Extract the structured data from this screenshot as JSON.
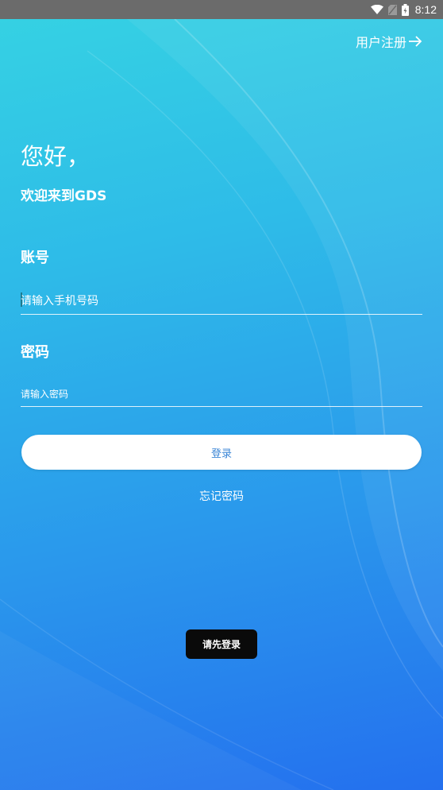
{
  "status_bar": {
    "time": "8:12",
    "icons": [
      "wifi-icon",
      "sim-card-icon",
      "battery-icon"
    ]
  },
  "header": {
    "register_label": "用户注册",
    "register_icon": "arrow-right-icon"
  },
  "greeting": {
    "title": "您好，",
    "subtitle": "欢迎来到GDS"
  },
  "form": {
    "account_label": "账号",
    "account_placeholder": "请输入手机号码",
    "account_value": "",
    "password_label": "密码",
    "password_placeholder": "请输入密码",
    "password_value": ""
  },
  "actions": {
    "login_label": "登录",
    "forgot_label": "忘记密码"
  },
  "toast": {
    "message": "请先登录"
  },
  "colors": {
    "gradient_top": "#35d1e3",
    "gradient_bottom": "#2470ee",
    "button_bg": "#ffffff",
    "button_text": "#3b86d6",
    "status_bar": "#6b6b6b",
    "toast_bg": "#0a0a0a"
  }
}
